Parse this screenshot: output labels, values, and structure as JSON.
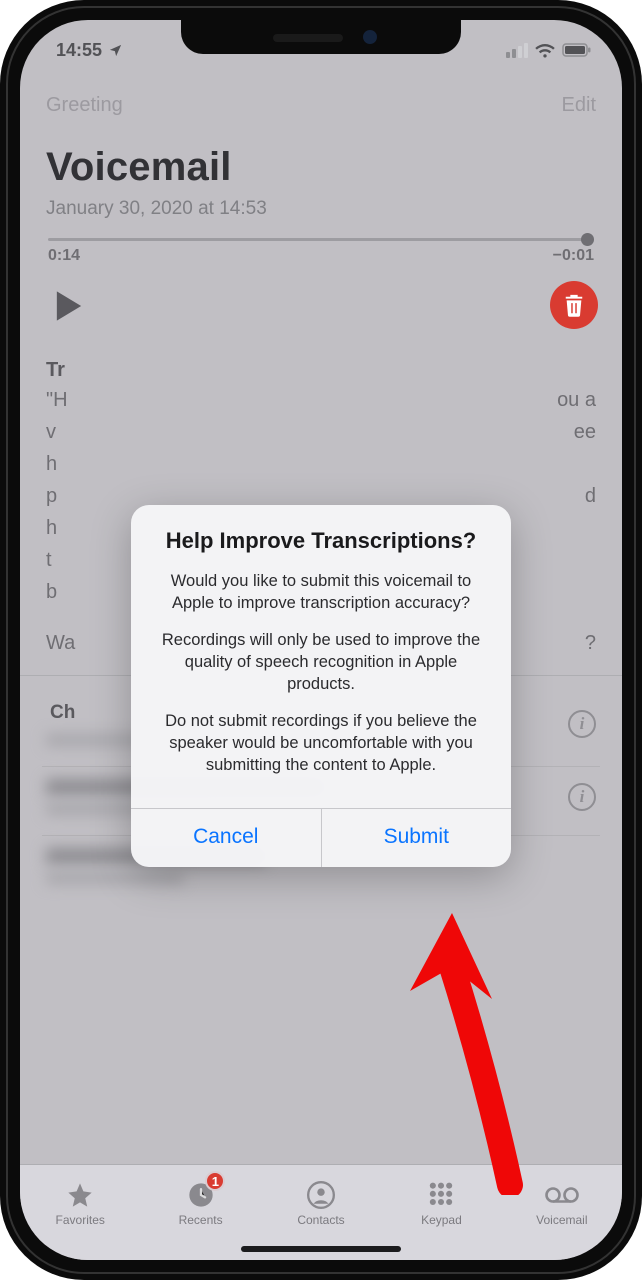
{
  "status": {
    "time": "14:55",
    "location_icon": "location-arrow"
  },
  "nav": {
    "left": "Greeting",
    "right": "Edit"
  },
  "page": {
    "title": "Voicemail",
    "date": "January 30, 2020 at 14:53"
  },
  "player": {
    "elapsed": "0:14",
    "remaining": "−0:01"
  },
  "transcription": {
    "heading_prefix": "Tr",
    "line1_left": "\"H",
    "line1_right": "ou a",
    "line2_left": "v",
    "line2_right": "ee",
    "line3": "h",
    "line4_left": "p",
    "line4_right": "d",
    "line5": "h",
    "line6": "t",
    "line7": "b",
    "was_left": "Wa",
    "was_right": "?"
  },
  "list": {
    "ch_label": "Ch"
  },
  "alert": {
    "title": "Help Improve Transcriptions?",
    "p1": "Would you like to submit this voicemail to Apple to improve transcription accuracy?",
    "p2": "Recordings will only be used to improve the quality of speech recognition in Apple products.",
    "p3": "Do not submit recordings if you believe the speaker would be uncomfortable with you submitting the content to Apple.",
    "cancel": "Cancel",
    "submit": "Submit"
  },
  "tabs": {
    "favorites": "Favorites",
    "recents": "Recents",
    "recents_badge": "1",
    "contacts": "Contacts",
    "keypad": "Keypad",
    "voicemail": "Voicemail"
  },
  "colors": {
    "accent": "#0a74ff",
    "danger": "#d93b31"
  }
}
